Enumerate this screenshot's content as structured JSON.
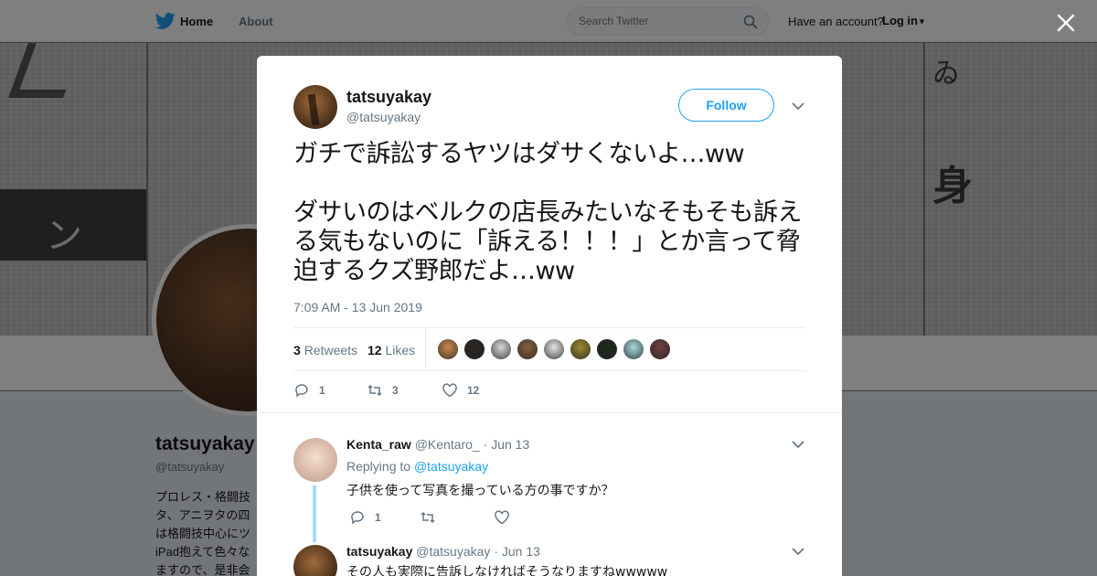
{
  "nav": {
    "home_label": "Home",
    "about_label": "About",
    "search_placeholder": "Search Twitter",
    "have_account": "Have an account?",
    "login_label": "Log in",
    "icons": [
      "twitter-bird-icon",
      "search-icon",
      "caret-down-icon",
      "close-icon"
    ]
  },
  "profile": {
    "name": "tatsuyakay",
    "handle": "@tatsuyakay",
    "bio": "プロレス・格闘技\nタ、アニヲタの四\nは格闘技中心にツ\niPad抱えて色々な\nますので、是非会"
  },
  "tweet": {
    "author_name": "tatsuyakay",
    "author_handle": "@tatsuyakay",
    "follow_label": "Follow",
    "text": "ガチで訴訟するヤツはダサくないよ…ww\n\nダサいのはベルクの店長みたいなそもそも訴える気もないのに「訴える！！！」とか言って脅迫するクズ野郎だよ…ww",
    "timestamp": "7:09 AM - 13 Jun 2019",
    "retweets_count": "3",
    "retweets_label": "Retweets",
    "likes_count": "12",
    "likes_label": "Likes",
    "liker_avatar_colors": [
      "#c98a4b",
      "#2b2420",
      "#d9d9d9",
      "#8a6040",
      "#e5e5e5",
      "#9a8a30",
      "#1c2a1c",
      "#a8d8e0",
      "#704040"
    ],
    "actions": {
      "reply_count": "1",
      "retweet_count": "3",
      "like_count": "12"
    }
  },
  "replies": [
    {
      "name": "Kenta_raw",
      "handle": "@Kentaro_",
      "date": "· Jun 13",
      "replying_label": "Replying to",
      "replying_to": "@tatsuyakay",
      "text": "子供を使って写真を撮っている方の事ですか？",
      "reply_count": "1",
      "retweet_count": "",
      "like_count": ""
    },
    {
      "name": "tatsuyakay",
      "handle": "@tatsuyakay",
      "date": "· Jun 13",
      "text": "その人も実際に告訴しなければそうなりますねwwwww"
    }
  ]
}
